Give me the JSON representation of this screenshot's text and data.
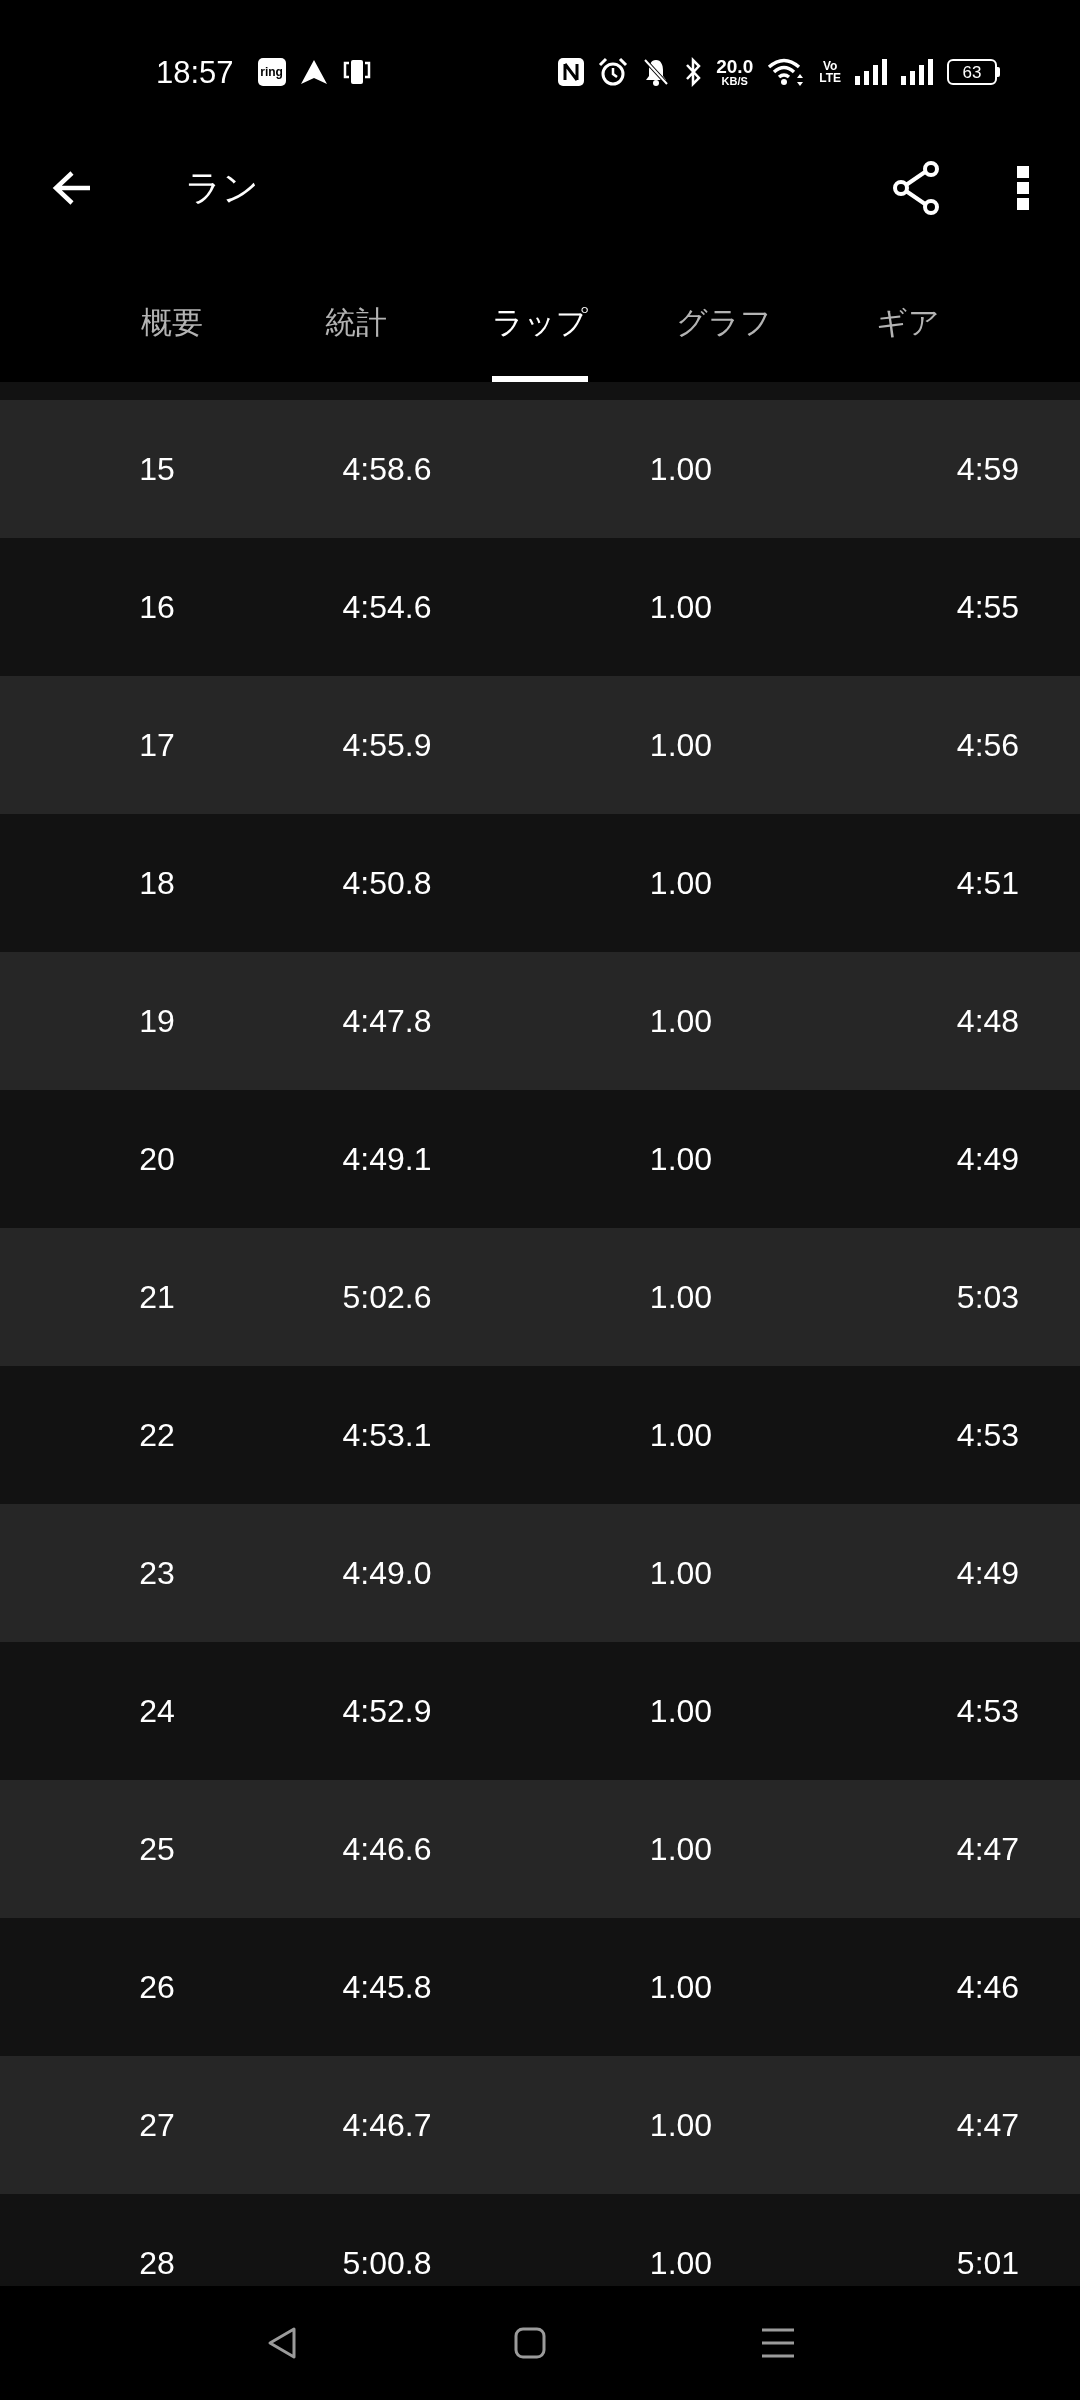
{
  "status_bar": {
    "time": "18:57",
    "notification_badge": "ring",
    "net_speed": {
      "value": "20.0",
      "unit": "KB/S"
    },
    "network_type": {
      "top": "Vo",
      "bottom": "LTE"
    },
    "battery": "63"
  },
  "app_bar": {
    "title": "ラン"
  },
  "tabs": [
    {
      "label": "概要",
      "selected": false
    },
    {
      "label": "統計",
      "selected": false
    },
    {
      "label": "ラップ",
      "selected": true
    },
    {
      "label": "グラフ",
      "selected": false
    },
    {
      "label": "ギア",
      "selected": false
    }
  ],
  "laps": {
    "rows": [
      [
        "15",
        "4:58.6",
        "1.00",
        "4:59"
      ],
      [
        "16",
        "4:54.6",
        "1.00",
        "4:55"
      ],
      [
        "17",
        "4:55.9",
        "1.00",
        "4:56"
      ],
      [
        "18",
        "4:50.8",
        "1.00",
        "4:51"
      ],
      [
        "19",
        "4:47.8",
        "1.00",
        "4:48"
      ],
      [
        "20",
        "4:49.1",
        "1.00",
        "4:49"
      ],
      [
        "21",
        "5:02.6",
        "1.00",
        "5:03"
      ],
      [
        "22",
        "4:53.1",
        "1.00",
        "4:53"
      ],
      [
        "23",
        "4:49.0",
        "1.00",
        "4:49"
      ],
      [
        "24",
        "4:52.9",
        "1.00",
        "4:53"
      ],
      [
        "25",
        "4:46.6",
        "1.00",
        "4:47"
      ],
      [
        "26",
        "4:45.8",
        "1.00",
        "4:46"
      ],
      [
        "27",
        "4:46.7",
        "1.00",
        "4:47"
      ],
      [
        "28",
        "5:00.8",
        "1.00",
        "5:01"
      ]
    ]
  }
}
